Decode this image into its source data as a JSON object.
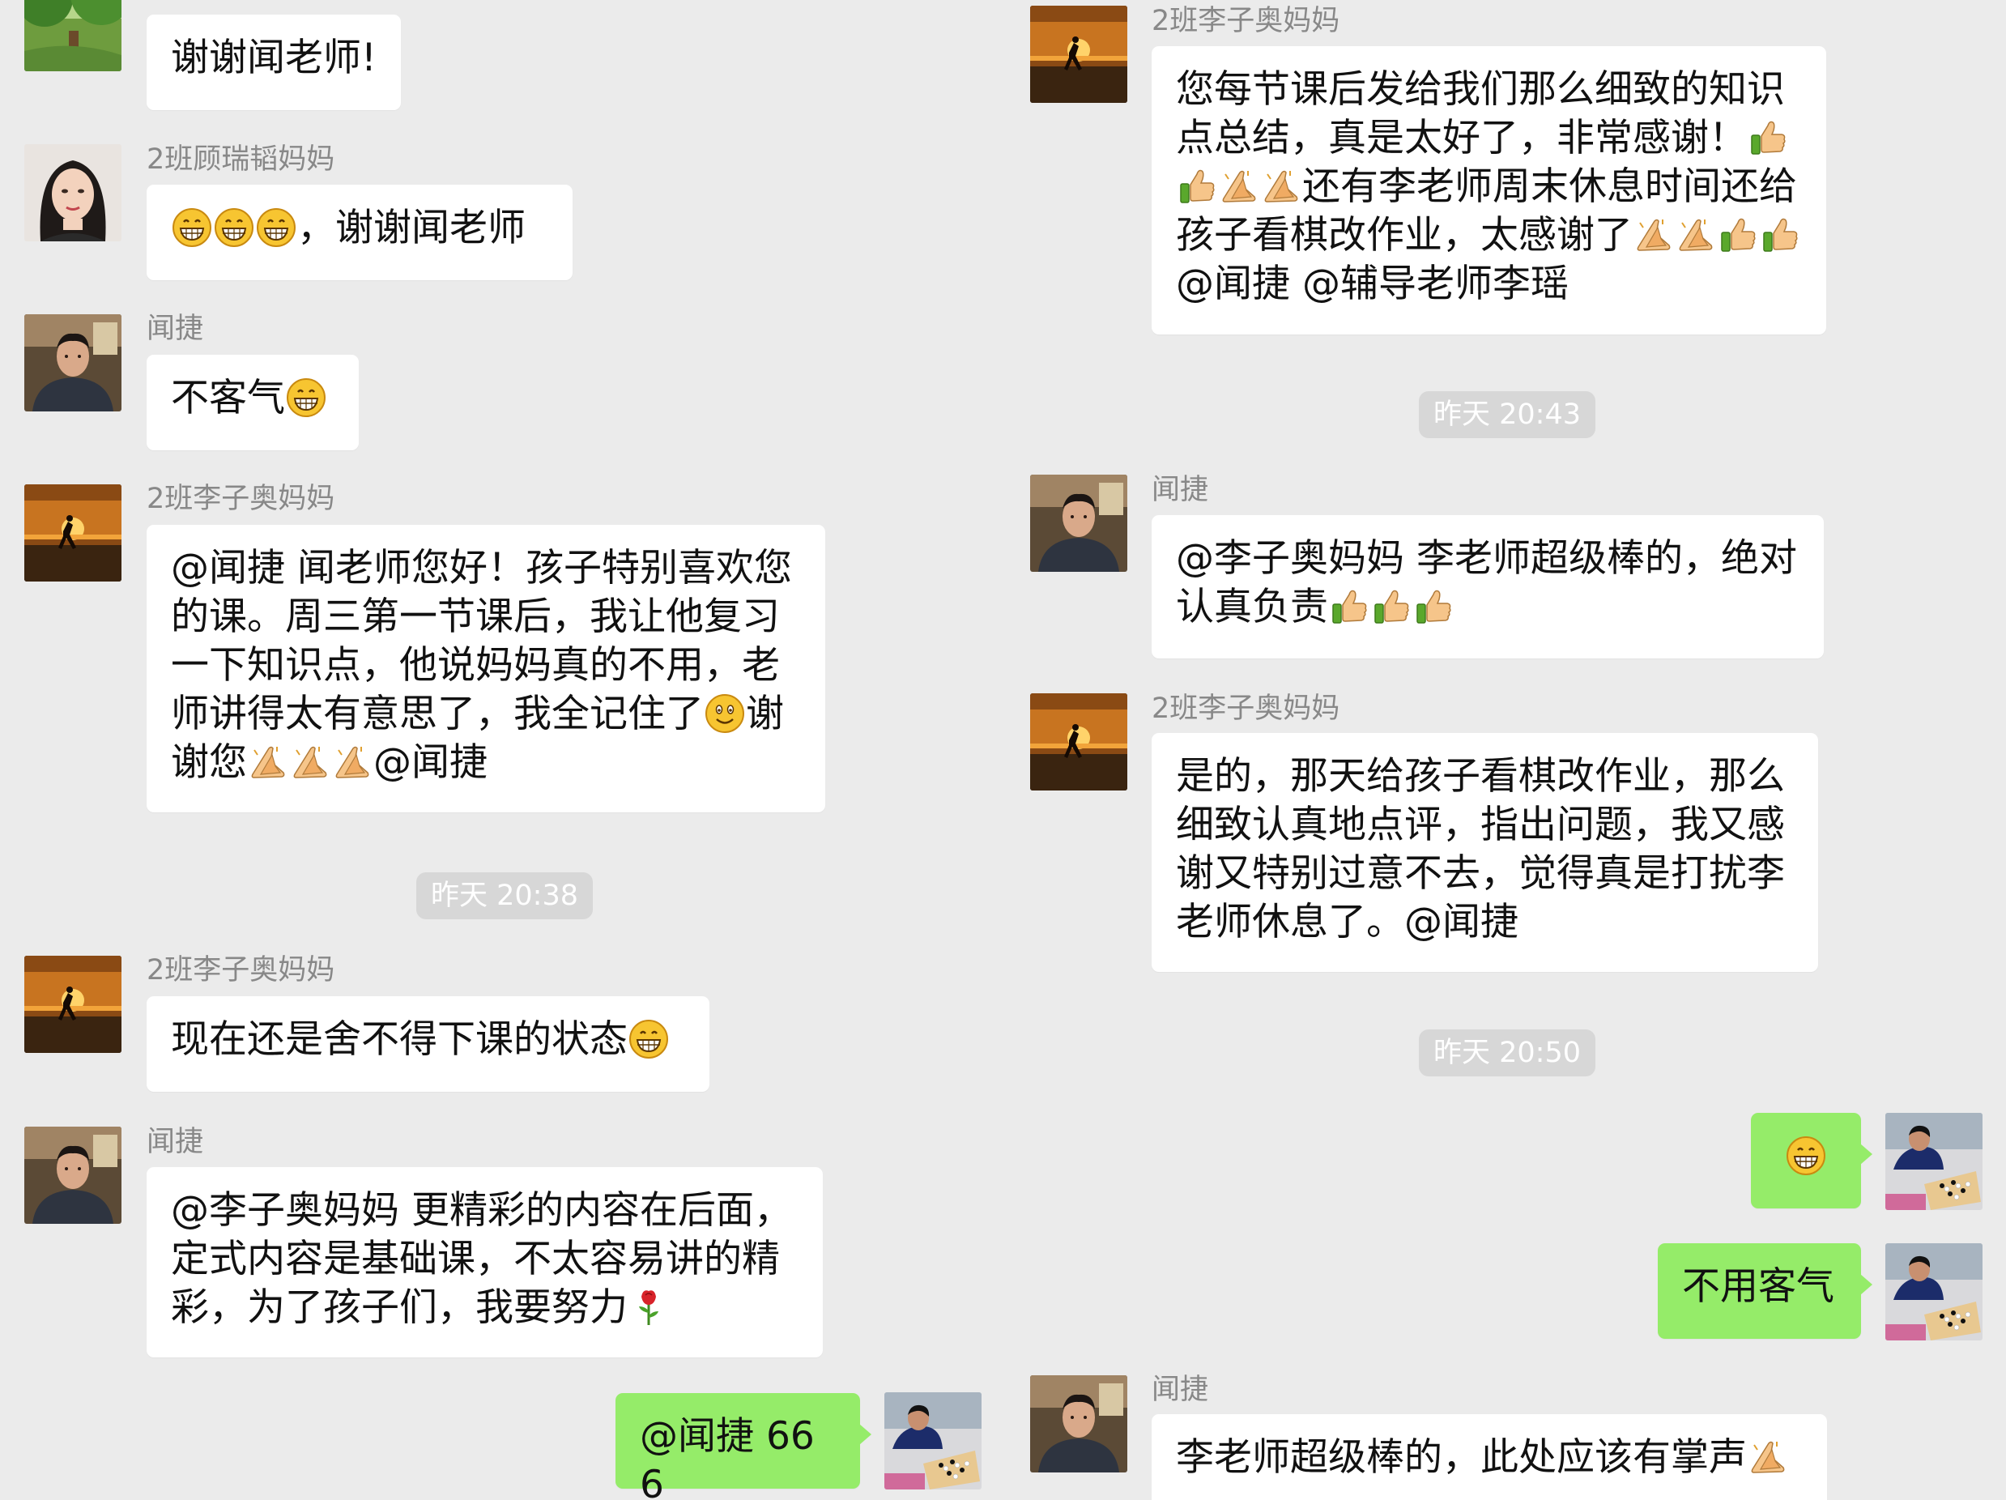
{
  "left": {
    "top_msg": {
      "text": "谢谢闻老师!"
    },
    "msg1": {
      "sender": "2班顾瑞韬妈妈",
      "text": "，谢谢闻老师"
    },
    "msg2": {
      "sender": "闻捷",
      "text": "不客气"
    },
    "msg3": {
      "sender": "2班李子奥妈妈",
      "text": "@闻捷  闻老师您好！孩子特别喜欢您的课。周三第一节课后，我让他复习一下知识点，他说妈妈真的不用，老师讲得太有意思了，我全记住了",
      "text_tail_1": "谢谢您",
      "text_tail_2": "@闻捷"
    },
    "time1": "昨天 20:38",
    "msg4": {
      "sender": "2班李子奥妈妈",
      "text": "现在还是舍不得下课的状态"
    },
    "msg5": {
      "sender": "闻捷",
      "text": "@李子奥妈妈 更精彩的内容在后面，定式内容是基础课，不太容易讲的精彩，为了孩子们，我要努力"
    },
    "msg6": {
      "text": "@闻捷 666"
    }
  },
  "right": {
    "msg1": {
      "sender": "2班李子奥妈妈",
      "text_a": "您每节课后发给我们那么细致的知识点总结，真是太好了，非常感谢！",
      "text_b": "还有李老师周末休息时间还给孩子看棋改作业，太感谢了",
      "text_c": "@闻捷 @辅导老师李瑶"
    },
    "time1": "昨天 20:43",
    "msg2": {
      "sender": "闻捷",
      "text": "@李子奥妈妈 李老师超级棒的，绝对认真负责"
    },
    "msg3": {
      "sender": "2班李子奥妈妈",
      "text": "是的，那天给孩子看棋改作业，那么细致认真地点评，指出问题，我又感谢又特别过意不去，觉得真是打扰李老师休息了。@闻捷"
    },
    "time2": "昨天 20:50",
    "msg5": {
      "text": "不用客气"
    },
    "msg6": {
      "sender": "闻捷",
      "text": "李老师超级棒的，此处应该有掌声"
    }
  },
  "colors": {
    "background": "#ebebeb",
    "bubble_other": "#ffffff",
    "bubble_me": "#95ec69",
    "sender_text": "#888888",
    "time_pill": "#d7d7d7"
  },
  "icons": [
    "grin-emoji",
    "smile-emoji",
    "thumbs-up-emoji",
    "clap-emoji",
    "rose-emoji"
  ]
}
